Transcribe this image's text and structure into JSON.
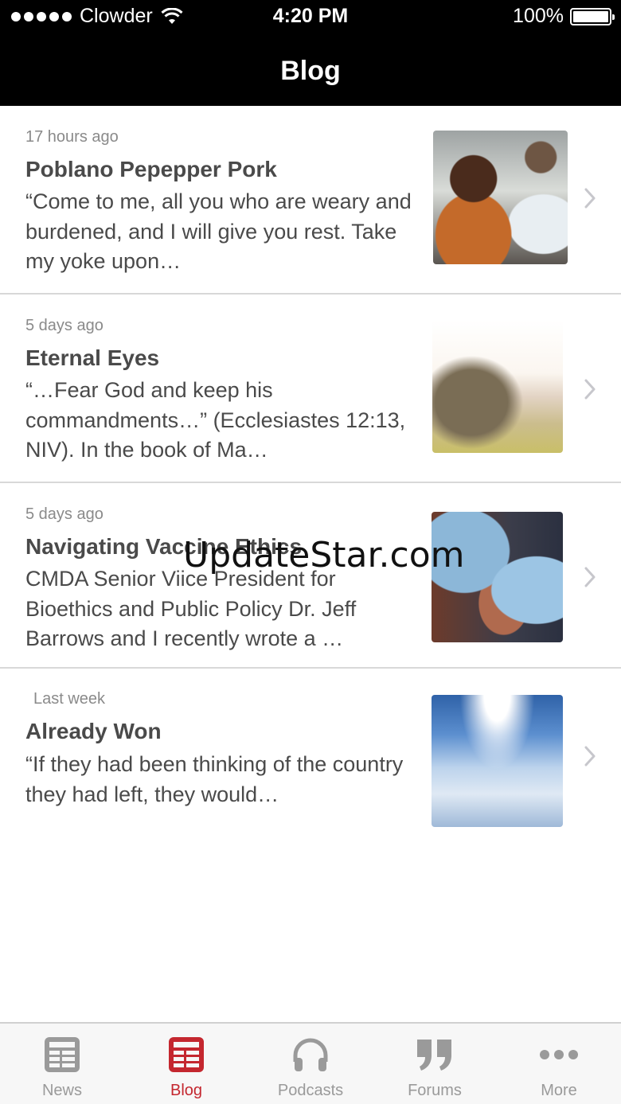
{
  "status_bar": {
    "carrier": "Clowder",
    "time": "4:20 PM",
    "battery": "100%",
    "battery_level": 1.0
  },
  "nav": {
    "title": "Blog"
  },
  "posts": [
    {
      "time": "17 hours ago",
      "title": "Poblano Pepepper Pork",
      "excerpt": "“Come to me, all you who are weary and burdened, and I will give you rest. Take my yoke upon…"
    },
    {
      "time": "5 days ago",
      "title": "Eternal Eyes",
      "excerpt": "“…Fear God and keep his commandments…” (Ecclesiastes 12:13, NIV). In the book of Ma…"
    },
    {
      "time": "5 days ago",
      "title": "Navigating Vaccine Ethics",
      "excerpt": "CMDA Senior Viice President for Bioethics and Public Policy Dr. Jeff Barrows and I recently wrote a …"
    },
    {
      "time": "Last week",
      "title": "Already Won",
      "excerpt": "“If they had been thinking of the country they had left, they would…"
    }
  ],
  "watermark": "UpdateStar.com",
  "tabs": [
    {
      "label": "News",
      "icon": "news-icon",
      "active": false
    },
    {
      "label": "Blog",
      "icon": "blog-icon",
      "active": true
    },
    {
      "label": "Podcasts",
      "icon": "headphones-icon",
      "active": false
    },
    {
      "label": "Forums",
      "icon": "quote-icon",
      "active": false
    },
    {
      "label": "More",
      "icon": "more-dots-icon",
      "active": false
    }
  ],
  "colors": {
    "accent": "#c4272f",
    "inactive_tab": "#9a9a9a",
    "nav_background": "#000000",
    "text": "#4a4a4a",
    "meta_text": "#8a8a8a"
  }
}
